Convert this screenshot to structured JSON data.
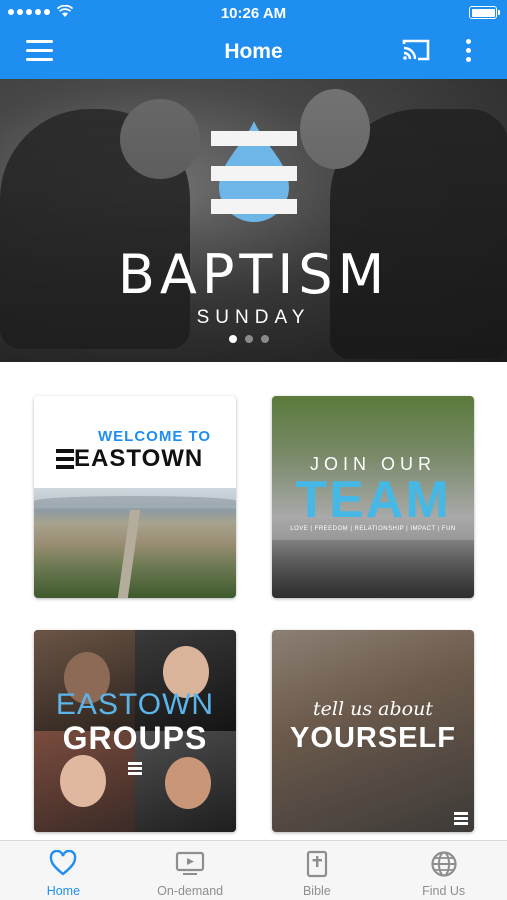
{
  "status_bar": {
    "time": "10:26 AM"
  },
  "app_bar": {
    "title": "Home",
    "icons": [
      "menu-icon",
      "cast-icon",
      "more-vertical-icon"
    ]
  },
  "hero": {
    "title": "BAPTISM",
    "subtitle": "SUNDAY",
    "slide_count": 3,
    "active_slide": 1
  },
  "tiles": [
    {
      "id": "welcome",
      "line1": "WELCOME TO",
      "line2": "EASTOWN"
    },
    {
      "id": "team",
      "line1": "JOIN OUR",
      "line2": "TEAM",
      "tagline": "LOVE | FREEDOM | RELATIONSHIP | IMPACT | FUN"
    },
    {
      "id": "groups",
      "line1": "EASTOWN",
      "line2": "GROUPS"
    },
    {
      "id": "yourself",
      "line1": "tell us about",
      "line2": "YOURSELF"
    }
  ],
  "tabbar": {
    "items": [
      {
        "label": "Home",
        "icon": "heart-icon",
        "active": true
      },
      {
        "label": "On-demand",
        "icon": "video-icon",
        "active": false
      },
      {
        "label": "Bible",
        "icon": "bible-icon",
        "active": false
      },
      {
        "label": "Find Us",
        "icon": "globe-icon",
        "active": false
      }
    ],
    "active_color": "#1f8ef1",
    "inactive_color": "#8e8e8e"
  },
  "colors": {
    "app_bar": "#1f8ef1",
    "accent_light_blue": "#46b8e6"
  }
}
